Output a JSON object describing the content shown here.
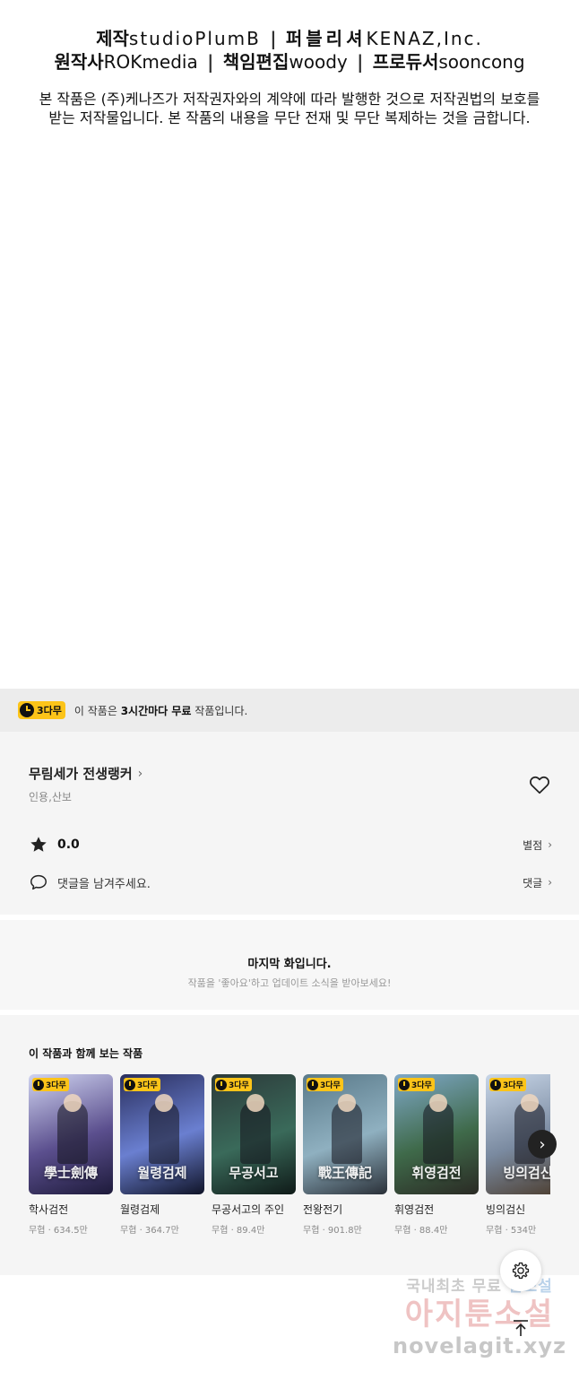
{
  "credits": {
    "line1": [
      {
        "label": "제작",
        "value": "studioPlumB"
      },
      {
        "label": "퍼블리셔",
        "value": "KENAZ,Inc."
      }
    ],
    "line2": [
      {
        "label": "원작사",
        "value": "ROKmedia"
      },
      {
        "label": "책임편집",
        "value": "woody"
      },
      {
        "label": "프로듀서",
        "value": "sooncong"
      }
    ],
    "separator": "|",
    "copyright_line1": "본 작품은 (주)케나즈가 저작권자와의 계약에 따라 발행한 것으로 저작권법의 보호를",
    "copyright_line2": "받는 저작물입니다. 본 작품의 내용을 무단 전재 및 무단 복제하는 것을 금합니다."
  },
  "free_banner": {
    "badge": "3다무",
    "text_prefix": "이 작품은 ",
    "text_bold": "3시간마다 무료",
    "text_suffix": " 작품입니다."
  },
  "work": {
    "title": "무림세가 전생랭커",
    "title_chevron": "›",
    "authors": "인용,산보",
    "rating": "0.0",
    "rating_link": "별점",
    "comment_prompt": "댓글을 남겨주세요.",
    "comment_link": "댓글",
    "chevron": "›"
  },
  "last_episode": {
    "title": "마지막 화입니다.",
    "subtitle": "작품을 '좋아요'하고 업데이트 소식을 받아보세요!"
  },
  "recommendations": {
    "heading": "이 작품과 함께 보는 작품",
    "badge": "3다무",
    "items": [
      {
        "name": "학사검전",
        "meta": "무협 · 634.5만",
        "art_text": "學士劍傳",
        "colors": [
          "#cfd3f0",
          "#5b4f8e",
          "#1d1a3a"
        ]
      },
      {
        "name": "월령검제",
        "meta": "무협 · 364.7만",
        "art_text": "월령검제",
        "colors": [
          "#2a2f5e",
          "#6a7fd0",
          "#101428"
        ]
      },
      {
        "name": "무공서고의 주인",
        "meta": "무협 · 89.4만",
        "art_text": "무공서고",
        "colors": [
          "#2c3a3a",
          "#3a6a5a",
          "#0f1a18"
        ]
      },
      {
        "name": "전왕전기",
        "meta": "무협 · 901.8만",
        "art_text": "戰王傳記",
        "colors": [
          "#5a7a8a",
          "#8fb0c0",
          "#2a3038"
        ]
      },
      {
        "name": "휘영검전",
        "meta": "무협 · 88.4만",
        "art_text": "휘영검전",
        "colors": [
          "#7fa8c8",
          "#3f6a4a",
          "#2a2a24"
        ]
      },
      {
        "name": "빙의검신",
        "meta": "무협 · 534만",
        "art_text": "빙의검신",
        "colors": [
          "#c8d6e8",
          "#7a8aa0",
          "#4a3a2a"
        ]
      }
    ],
    "next_icon": "›"
  },
  "floating": {
    "settings_icon": "gear-icon",
    "top_icon": "arrow-up-icon"
  },
  "watermark": {
    "line1_a": "국내최초 무료 ",
    "line1_b": "웹소설",
    "line2": "아지툰소설",
    "line3": "novelagit.xyz"
  },
  "colors": {
    "badge_yellow": "#fcc419",
    "panel_gray": "#f5f5f5",
    "banner_gray": "#ececec"
  }
}
